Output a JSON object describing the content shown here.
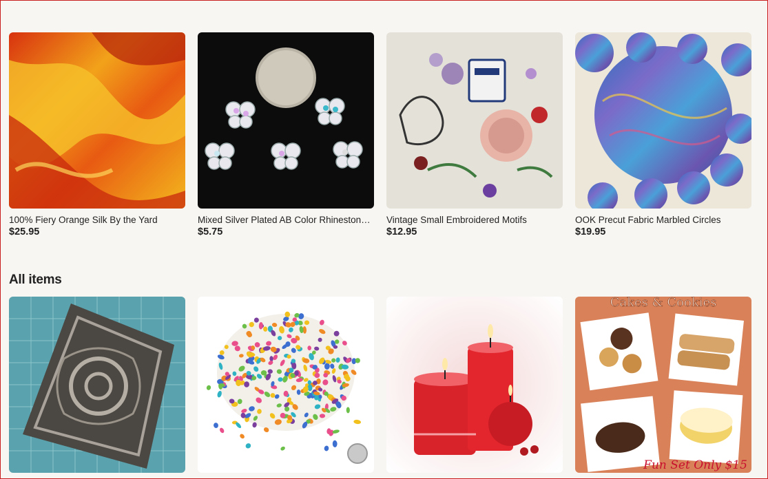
{
  "featured": [
    {
      "title": "100% Fiery Orange Silk By the Yard",
      "price": "$25.95"
    },
    {
      "title": "Mixed Silver Plated AB Color Rhinestone Butterfly Charms",
      "price": "$5.75"
    },
    {
      "title": "Vintage Small Embroidered Motifs",
      "price": "$12.95"
    },
    {
      "title": "OOK Precut Fabric Marbled Circles",
      "price": "$19.95"
    }
  ],
  "all_items": {
    "heading": "All items",
    "cards": [
      {
        "image_text": ""
      },
      {
        "image_text": ""
      },
      {
        "image_text": ""
      },
      {
        "image_text_top": "Cakes & Cookies",
        "image_text_bottom": "Fun Set Only $15"
      }
    ]
  },
  "colors": {
    "frame": "#c81e1e",
    "background": "#f8f6f2"
  }
}
